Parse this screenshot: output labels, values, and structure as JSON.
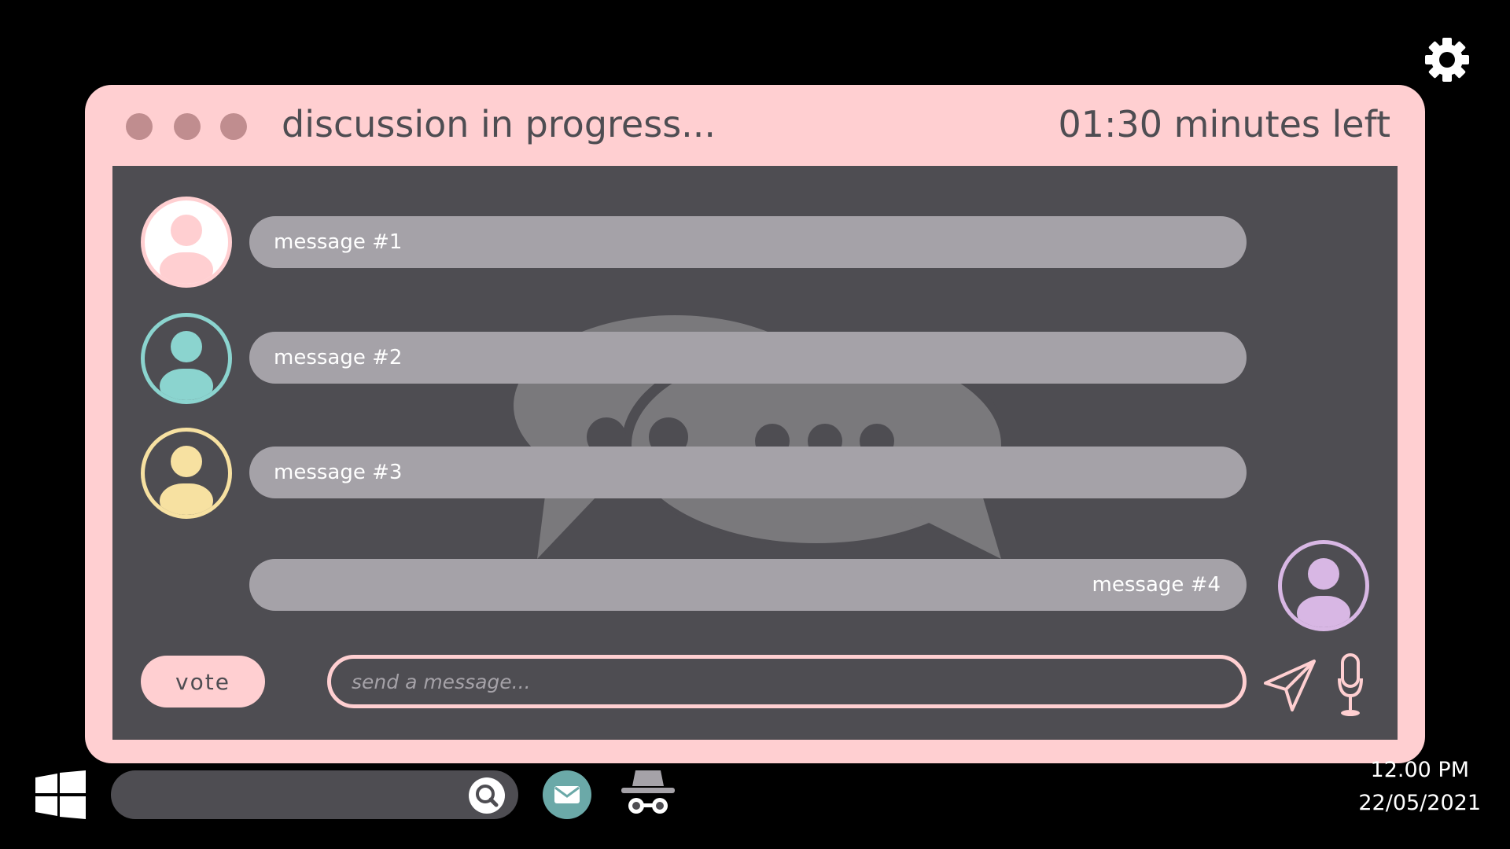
{
  "window": {
    "title": "discussion in progress...",
    "timer": "01:30 minutes left",
    "controls": [
      "close",
      "minimize",
      "maximize"
    ]
  },
  "messages": [
    {
      "text": "message #1",
      "avatar_color": "#ffcfd1",
      "align": "left"
    },
    {
      "text": "message #2",
      "avatar_color": "#8bd4cf",
      "align": "left"
    },
    {
      "text": "message #3",
      "avatar_color": "#f7e1a1",
      "align": "left"
    },
    {
      "text": "message #4",
      "avatar_color": "#d8b7e4",
      "align": "right"
    }
  ],
  "composer": {
    "vote_label": "vote",
    "placeholder": "send a message...",
    "value": ""
  },
  "taskbar": {
    "time": "12.00 PM",
    "date": "22/05/2021"
  },
  "icons": [
    "gear-icon",
    "chat-bubbles-icon",
    "send-icon",
    "microphone-icon",
    "windows-start-icon",
    "search-icon",
    "mail-icon",
    "spy-incognito-icon"
  ],
  "colors": {
    "window_bg": "#ffcfd1",
    "content_bg": "#4e4d52",
    "bubble_bg": "#a5a2a8",
    "text_dark": "#4e4d52",
    "dot": "#c08d8f",
    "mail_bg": "#6ba9a8"
  }
}
